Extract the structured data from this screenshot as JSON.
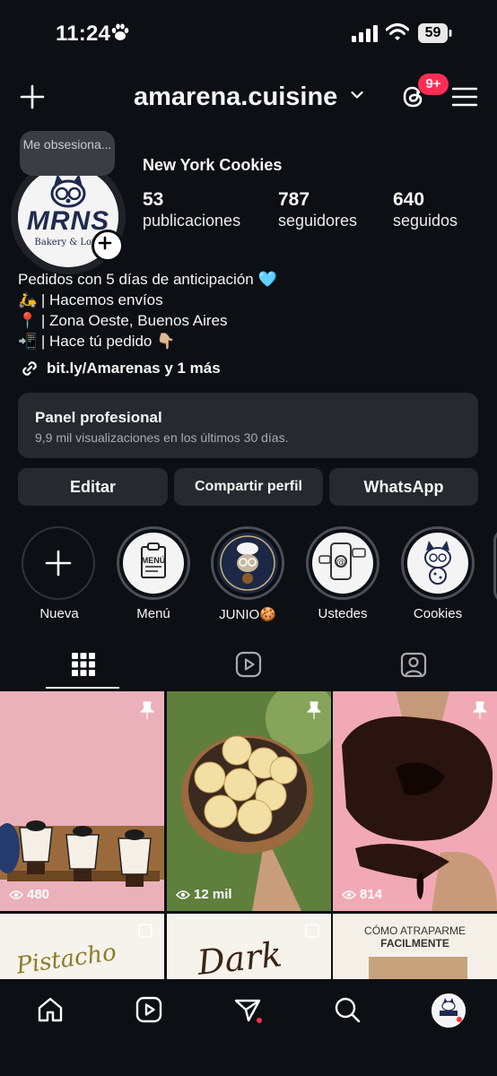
{
  "status_bar": {
    "time": "11:24",
    "battery": "59"
  },
  "header": {
    "username": "amarena.cuisine",
    "notification_badge": "9+"
  },
  "profile": {
    "note": "Me obsesiona...",
    "avatar_brand": "MRNS",
    "avatar_tagline": "Bakery & Love",
    "display_name": "New York Cookies",
    "stats": [
      {
        "value": "53",
        "label": "publicaciones"
      },
      {
        "value": "787",
        "label": "seguidores"
      },
      {
        "value": "640",
        "label": "seguidos"
      }
    ],
    "bio": [
      "Pedidos con 5 días de anticipación 🩵",
      "🛵 | Hacemos envíos",
      "📍 | Zona Oeste, Buenos Aires",
      "📲 | Hace tú pedido 👇🏼"
    ],
    "link": "bit.ly/Amarenas y 1 más"
  },
  "panel": {
    "title": "Panel profesional",
    "subtitle": "9,9 mil visualizaciones en los últimos 30 días."
  },
  "buttons": {
    "edit": "Editar",
    "share": "Compartir perfil",
    "whatsapp": "WhatsApp"
  },
  "highlights": [
    {
      "label": "Nueva",
      "icon": "plus-icon"
    },
    {
      "label": "Menú",
      "icon": "menu-clipboard-icon",
      "inner_text": "MENÚ"
    },
    {
      "label": "JUNIO🍪",
      "icon": "chef-mascot-icon"
    },
    {
      "label": "Ustedes",
      "icon": "phone-chat-icon"
    },
    {
      "label": "Cookies",
      "icon": "cookie-mascot-icon"
    }
  ],
  "posts": [
    {
      "views": "480",
      "pinned": true,
      "scene": "oreo-dessert-cups"
    },
    {
      "views": "12 mil",
      "pinned": true,
      "scene": "cheese-bread-bowl"
    },
    {
      "views": "814",
      "pinned": true,
      "scene": "chocolate-cookie"
    },
    {
      "caption": "Pistacho",
      "scene": "pistachio-card"
    },
    {
      "caption": "Dark",
      "scene": "dark-card"
    },
    {
      "caption_line1": "CÓMO ATRAPARME",
      "caption_line2": "FACILMENTE",
      "scene": "text-card"
    }
  ],
  "colors": {
    "background": "#0c0f14",
    "surface": "#26292f",
    "badge": "#ff2d55",
    "heart": "#6ec6f5"
  }
}
